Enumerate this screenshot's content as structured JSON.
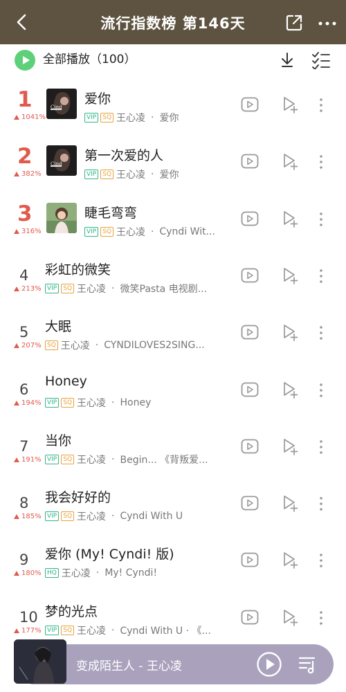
{
  "header": {
    "title": "流行指数榜 第146天"
  },
  "toolbar": {
    "play_all_label": "全部播放（100）"
  },
  "colors": {
    "header_bg": "#5e5340",
    "rank_top": "#e05a4e",
    "trend_up": "#e05a4e",
    "vip": "#2fb58a",
    "sq": "#e8a23a",
    "play_all": "#5fd07a",
    "mini_player_bg": "#aaa2bd"
  },
  "songs": [
    {
      "rank": "1",
      "title": "爱你",
      "trend": "1041%",
      "badges": [
        "VIP",
        "SQ"
      ],
      "artist": "王心凌",
      "album": "爱你",
      "cover": "cover-aini"
    },
    {
      "rank": "2",
      "title": "第一次爱的人",
      "trend": "382%",
      "badges": [
        "VIP",
        "SQ"
      ],
      "artist": "王心凌",
      "album": "爱你",
      "cover": "cover-aini"
    },
    {
      "rank": "3",
      "title": "睫毛弯弯",
      "trend": "316%",
      "badges": [
        "VIP",
        "SQ"
      ],
      "artist": "王心凌",
      "album": "Cyndi Wit...",
      "cover": "cover-cyndi"
    },
    {
      "rank": "4",
      "title": "彩虹的微笑",
      "trend": "213%",
      "badges": [
        "VIP",
        "SQ"
      ],
      "artist": "王心凌",
      "album": "微笑Pasta 电视剧..."
    },
    {
      "rank": "5",
      "title": "大眠",
      "trend": "207%",
      "badges": [
        "SQ"
      ],
      "artist": "王心凌",
      "album": "CYNDILOVES2SING..."
    },
    {
      "rank": "6",
      "title": "Honey",
      "trend": "194%",
      "badges": [
        "VIP",
        "SQ"
      ],
      "artist": "王心凌",
      "album": "Honey"
    },
    {
      "rank": "7",
      "title": "当你",
      "trend": "191%",
      "badges": [
        "VIP",
        "SQ"
      ],
      "artist": "王心凌",
      "album": "Begin... 《背叛爱..."
    },
    {
      "rank": "8",
      "title": "我会好好的",
      "trend": "185%",
      "badges": [
        "VIP",
        "SQ"
      ],
      "artist": "王心凌",
      "album": "Cyndi With U"
    },
    {
      "rank": "9",
      "title": "爱你 (My! Cyndi! 版)",
      "trend": "180%",
      "badges": [
        "HQ"
      ],
      "artist": "王心凌",
      "album": "My! Cyndi!"
    },
    {
      "rank": "10",
      "title": "梦的光点",
      "trend": "177%",
      "badges": [
        "VIP",
        "SQ"
      ],
      "artist": "王心凌",
      "album": "Cyndi With U · 《..."
    }
  ],
  "meta_separator": "·",
  "now_playing": {
    "text": "变成陌生人 - 王心凌"
  }
}
